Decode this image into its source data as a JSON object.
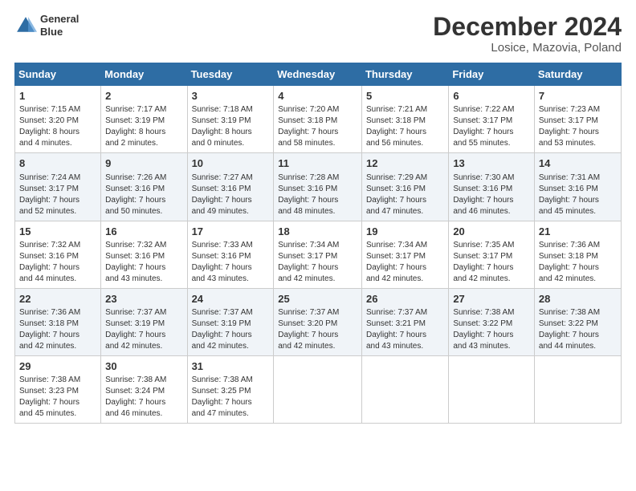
{
  "logo": {
    "line1": "General",
    "line2": "Blue"
  },
  "title": "December 2024",
  "subtitle": "Losice, Mazovia, Poland",
  "days_of_week": [
    "Sunday",
    "Monday",
    "Tuesday",
    "Wednesday",
    "Thursday",
    "Friday",
    "Saturday"
  ],
  "weeks": [
    [
      {
        "day": 1,
        "lines": [
          "Sunrise: 7:15 AM",
          "Sunset: 3:20 PM",
          "Daylight: 8 hours",
          "and 4 minutes."
        ]
      },
      {
        "day": 2,
        "lines": [
          "Sunrise: 7:17 AM",
          "Sunset: 3:19 PM",
          "Daylight: 8 hours",
          "and 2 minutes."
        ]
      },
      {
        "day": 3,
        "lines": [
          "Sunrise: 7:18 AM",
          "Sunset: 3:19 PM",
          "Daylight: 8 hours",
          "and 0 minutes."
        ]
      },
      {
        "day": 4,
        "lines": [
          "Sunrise: 7:20 AM",
          "Sunset: 3:18 PM",
          "Daylight: 7 hours",
          "and 58 minutes."
        ]
      },
      {
        "day": 5,
        "lines": [
          "Sunrise: 7:21 AM",
          "Sunset: 3:18 PM",
          "Daylight: 7 hours",
          "and 56 minutes."
        ]
      },
      {
        "day": 6,
        "lines": [
          "Sunrise: 7:22 AM",
          "Sunset: 3:17 PM",
          "Daylight: 7 hours",
          "and 55 minutes."
        ]
      },
      {
        "day": 7,
        "lines": [
          "Sunrise: 7:23 AM",
          "Sunset: 3:17 PM",
          "Daylight: 7 hours",
          "and 53 minutes."
        ]
      }
    ],
    [
      {
        "day": 8,
        "lines": [
          "Sunrise: 7:24 AM",
          "Sunset: 3:17 PM",
          "Daylight: 7 hours",
          "and 52 minutes."
        ]
      },
      {
        "day": 9,
        "lines": [
          "Sunrise: 7:26 AM",
          "Sunset: 3:16 PM",
          "Daylight: 7 hours",
          "and 50 minutes."
        ]
      },
      {
        "day": 10,
        "lines": [
          "Sunrise: 7:27 AM",
          "Sunset: 3:16 PM",
          "Daylight: 7 hours",
          "and 49 minutes."
        ]
      },
      {
        "day": 11,
        "lines": [
          "Sunrise: 7:28 AM",
          "Sunset: 3:16 PM",
          "Daylight: 7 hours",
          "and 48 minutes."
        ]
      },
      {
        "day": 12,
        "lines": [
          "Sunrise: 7:29 AM",
          "Sunset: 3:16 PM",
          "Daylight: 7 hours",
          "and 47 minutes."
        ]
      },
      {
        "day": 13,
        "lines": [
          "Sunrise: 7:30 AM",
          "Sunset: 3:16 PM",
          "Daylight: 7 hours",
          "and 46 minutes."
        ]
      },
      {
        "day": 14,
        "lines": [
          "Sunrise: 7:31 AM",
          "Sunset: 3:16 PM",
          "Daylight: 7 hours",
          "and 45 minutes."
        ]
      }
    ],
    [
      {
        "day": 15,
        "lines": [
          "Sunrise: 7:32 AM",
          "Sunset: 3:16 PM",
          "Daylight: 7 hours",
          "and 44 minutes."
        ]
      },
      {
        "day": 16,
        "lines": [
          "Sunrise: 7:32 AM",
          "Sunset: 3:16 PM",
          "Daylight: 7 hours",
          "and 43 minutes."
        ]
      },
      {
        "day": 17,
        "lines": [
          "Sunrise: 7:33 AM",
          "Sunset: 3:16 PM",
          "Daylight: 7 hours",
          "and 43 minutes."
        ]
      },
      {
        "day": 18,
        "lines": [
          "Sunrise: 7:34 AM",
          "Sunset: 3:17 PM",
          "Daylight: 7 hours",
          "and 42 minutes."
        ]
      },
      {
        "day": 19,
        "lines": [
          "Sunrise: 7:34 AM",
          "Sunset: 3:17 PM",
          "Daylight: 7 hours",
          "and 42 minutes."
        ]
      },
      {
        "day": 20,
        "lines": [
          "Sunrise: 7:35 AM",
          "Sunset: 3:17 PM",
          "Daylight: 7 hours",
          "and 42 minutes."
        ]
      },
      {
        "day": 21,
        "lines": [
          "Sunrise: 7:36 AM",
          "Sunset: 3:18 PM",
          "Daylight: 7 hours",
          "and 42 minutes."
        ]
      }
    ],
    [
      {
        "day": 22,
        "lines": [
          "Sunrise: 7:36 AM",
          "Sunset: 3:18 PM",
          "Daylight: 7 hours",
          "and 42 minutes."
        ]
      },
      {
        "day": 23,
        "lines": [
          "Sunrise: 7:37 AM",
          "Sunset: 3:19 PM",
          "Daylight: 7 hours",
          "and 42 minutes."
        ]
      },
      {
        "day": 24,
        "lines": [
          "Sunrise: 7:37 AM",
          "Sunset: 3:19 PM",
          "Daylight: 7 hours",
          "and 42 minutes."
        ]
      },
      {
        "day": 25,
        "lines": [
          "Sunrise: 7:37 AM",
          "Sunset: 3:20 PM",
          "Daylight: 7 hours",
          "and 42 minutes."
        ]
      },
      {
        "day": 26,
        "lines": [
          "Sunrise: 7:37 AM",
          "Sunset: 3:21 PM",
          "Daylight: 7 hours",
          "and 43 minutes."
        ]
      },
      {
        "day": 27,
        "lines": [
          "Sunrise: 7:38 AM",
          "Sunset: 3:22 PM",
          "Daylight: 7 hours",
          "and 43 minutes."
        ]
      },
      {
        "day": 28,
        "lines": [
          "Sunrise: 7:38 AM",
          "Sunset: 3:22 PM",
          "Daylight: 7 hours",
          "and 44 minutes."
        ]
      }
    ],
    [
      {
        "day": 29,
        "lines": [
          "Sunrise: 7:38 AM",
          "Sunset: 3:23 PM",
          "Daylight: 7 hours",
          "and 45 minutes."
        ]
      },
      {
        "day": 30,
        "lines": [
          "Sunrise: 7:38 AM",
          "Sunset: 3:24 PM",
          "Daylight: 7 hours",
          "and 46 minutes."
        ]
      },
      {
        "day": 31,
        "lines": [
          "Sunrise: 7:38 AM",
          "Sunset: 3:25 PM",
          "Daylight: 7 hours",
          "and 47 minutes."
        ]
      },
      null,
      null,
      null,
      null
    ]
  ]
}
